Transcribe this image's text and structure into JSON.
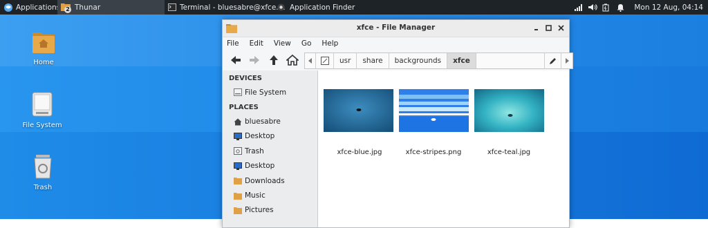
{
  "panel": {
    "applications_label": "Applications",
    "tasks": [
      {
        "label": "Thunar",
        "badge": "2",
        "active": true
      },
      {
        "label": "Terminal - bluesabre@xfce...."
      },
      {
        "label": "Application Finder"
      }
    ],
    "tray_icons": [
      "network-signal-icon",
      "volume-icon",
      "battery-icon",
      "notification-bell-icon"
    ],
    "clock": "Mon 12 Aug, 04:14"
  },
  "desktop": {
    "icons": [
      {
        "label": "Home",
        "icon": "home-folder-icon"
      },
      {
        "label": "File System",
        "icon": "drive-icon"
      },
      {
        "label": "Trash",
        "icon": "trash-icon"
      }
    ]
  },
  "window": {
    "title": "xfce - File Manager",
    "menu": [
      "File",
      "Edit",
      "View",
      "Go",
      "Help"
    ],
    "path": [
      "usr",
      "share",
      "backgrounds",
      "xfce"
    ],
    "sidebar": {
      "devices_label": "DEVICES",
      "devices": [
        {
          "label": "File System",
          "icon": "drive-icon"
        }
      ],
      "places_label": "PLACES",
      "places": [
        {
          "label": "bluesabre",
          "icon": "home-icon"
        },
        {
          "label": "Desktop",
          "icon": "desktop-icon"
        },
        {
          "label": "Trash",
          "icon": "trash-icon"
        },
        {
          "label": "Desktop",
          "icon": "desktop-icon"
        },
        {
          "label": "Downloads",
          "icon": "folder-icon"
        },
        {
          "label": "Music",
          "icon": "folder-icon"
        },
        {
          "label": "Pictures",
          "icon": "folder-icon"
        }
      ]
    },
    "files": [
      {
        "name": "xfce-blue.jpg"
      },
      {
        "name": "xfce-stripes.png"
      },
      {
        "name": "xfce-teal.jpg"
      }
    ]
  },
  "colors": {
    "panel_bg": "#1e2328",
    "desktop_blue": "#1f8ae6",
    "folder_orange": "#e0a046",
    "selected_crumb": "#dcdcdc"
  }
}
